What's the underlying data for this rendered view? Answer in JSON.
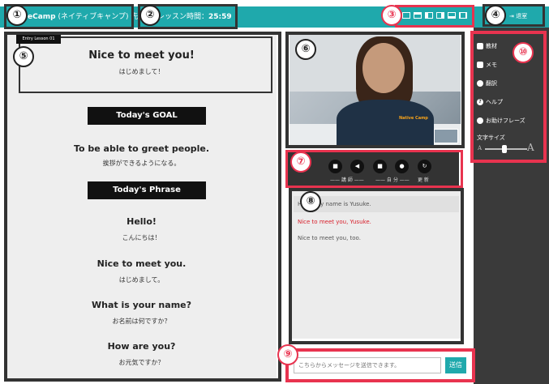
{
  "header": {
    "brand_name": "eCamp",
    "brand_sub": "(ネイティブキャンプ) 先",
    "lesson_time_label": "レッスン時間：",
    "lesson_time_value": "25:59",
    "exit_label": "退室",
    "accent_color": "#1fa9ac"
  },
  "badges": [
    "①",
    "②",
    "③",
    "④",
    "⑤",
    "⑥",
    "⑦",
    "⑧",
    "⑨",
    "⑩"
  ],
  "lesson": {
    "tag": "Entry Lesson 01",
    "title": "Nice to meet you!",
    "title_jp": "はじめまして！",
    "goal_heading": "Today's GOAL",
    "goal_text": "To be able to greet people.",
    "goal_jp": "挨拶ができるようになる。",
    "phrase_heading": "Today's Phrase",
    "phrases": [
      {
        "en": "Hello!",
        "jp": "こんにちは！"
      },
      {
        "en": "Nice to meet you.",
        "jp": "はじめまして。"
      },
      {
        "en": "What is your name?",
        "jp": "お名前は何ですか？"
      },
      {
        "en": "How are you?",
        "jp": "お元気ですか？"
      }
    ]
  },
  "video": {
    "shirt_logo": "Native Camp"
  },
  "controls": {
    "buttons": [
      {
        "icon": "camera-icon",
        "glyph": "■"
      },
      {
        "icon": "speaker-icon",
        "glyph": "◀"
      },
      {
        "icon": "camera-icon",
        "glyph": "■"
      },
      {
        "icon": "mic-icon",
        "glyph": "●"
      },
      {
        "icon": "refresh-icon",
        "glyph": "↻"
      }
    ],
    "teacher_label": "講 師",
    "self_label": "自 分",
    "refresh_label": "更 新"
  },
  "chat": {
    "messages": [
      {
        "text": "Hello. My name is Yusuke.",
        "highlight": false
      },
      {
        "text": "Nice to meet you, Yusuke.",
        "highlight": true
      },
      {
        "text": "Nice to meet you, too.",
        "highlight": false
      }
    ],
    "input_placeholder": "こちらからメッセージを送信できます。",
    "send_label": "送信"
  },
  "side_menu": {
    "items": [
      {
        "label": "教材",
        "icon": "book-icon"
      },
      {
        "label": "メモ",
        "icon": "memo-icon"
      },
      {
        "label": "翻訳",
        "icon": "translate-icon"
      },
      {
        "label": "ヘルプ",
        "icon": "help-icon"
      },
      {
        "label": "お助けフレーズ",
        "icon": "chat-bubble-icon"
      }
    ],
    "font_size_label": "文字サイズ",
    "font_small": "A",
    "font_large": "A",
    "font_size_level": 0.45
  },
  "colors": {
    "callout_dark": "#333333",
    "callout_red": "#e8334f",
    "highlight_text": "#d8202c",
    "side_bg": "#3a3a3a"
  }
}
